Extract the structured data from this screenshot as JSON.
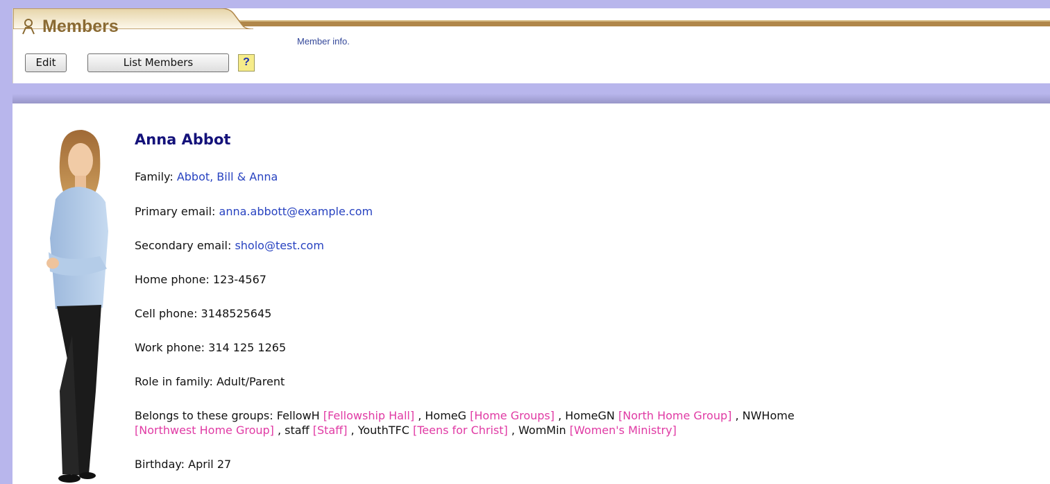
{
  "header": {
    "title": "Members",
    "subtitle": "Member info.",
    "accent_color": "#b0874a",
    "title_color": "#8a6a32"
  },
  "toolbar": {
    "edit_label": "Edit",
    "list_label": "List Members",
    "help_label": "?"
  },
  "member": {
    "name": "Anna Abbot",
    "family_label": "Family:",
    "family_value": "Abbot, Bill & Anna",
    "primary_email_label": "Primary email:",
    "primary_email_value": "anna.abbott@example.com",
    "secondary_email_label": "Secondary email:",
    "secondary_email_value": "sholo@test.com",
    "home_phone_label": "Home phone:",
    "home_phone_value": "123-4567",
    "cell_phone_label": "Cell phone:",
    "cell_phone_value": "3148525645",
    "work_phone_label": "Work phone:",
    "work_phone_value": "314 125 1265",
    "role_label": "Role in family:",
    "role_value": "Adult/Parent",
    "groups_label": "Belongs to these groups:",
    "groups": [
      {
        "code": "FellowH",
        "name": "[Fellowship Hall]"
      },
      {
        "code": "HomeG",
        "name": "[Home Groups]"
      },
      {
        "code": "HomeGN",
        "name": "[North Home Group]"
      },
      {
        "code": "NWHome",
        "name": "[Northwest Home Group]"
      },
      {
        "code": "staff",
        "name": "[Staff]"
      },
      {
        "code": "YouthTFC",
        "name": "[Teens for Christ]"
      },
      {
        "code": "WomMin",
        "name": "[Women's Ministry]"
      }
    ],
    "birthday_label": "Birthday:",
    "birthday_value": "April 27"
  },
  "colors": {
    "background": "#b8b6ec",
    "link": "#2742c0",
    "group_name": "#e03aa4",
    "name": "#14127a"
  },
  "icons": {
    "title_icon": "person-outline-icon",
    "help_icon": "question-mark-icon"
  }
}
